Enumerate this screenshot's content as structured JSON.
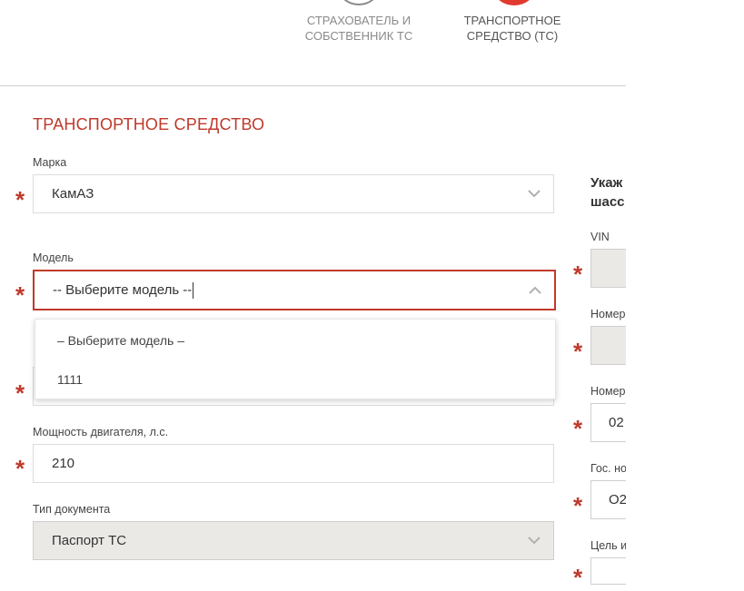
{
  "stepper": {
    "step1_label": "СТРАХОВАТЕЛЬ И\nСОБСТВЕННИК ТС",
    "step2_label": "ТРАНСПОРТНОЕ\nСРЕДСТВО (ТС)",
    "active_color": "#e03a2f"
  },
  "section": {
    "title": "ТРАНСПОРТНОЕ СРЕДСТВО"
  },
  "form": {
    "brand": {
      "label": "Марка",
      "value": "КамАЗ"
    },
    "model": {
      "label": "Модель",
      "value": "-- Выберите модель --"
    },
    "power": {
      "label": "Мощность двигателя, л.с.",
      "value": "210"
    },
    "doc_type": {
      "label": "Тип документа",
      "value": "Паспорт ТС"
    }
  },
  "model_dropdown": {
    "options": [
      "– Выберите модель –",
      "1111"
    ]
  },
  "right_panel": {
    "heading_line1": "Укаж",
    "heading_line2": "шасс",
    "vin_label": "VIN",
    "number1_label": "Номер",
    "number2_label": "Номер",
    "number2_value": "02",
    "gos_label": "Гос. но",
    "gos_value": "O2",
    "purpose_label": "Цель и"
  },
  "colors": {
    "accent": "#c0392b",
    "grey_field": "#ebe9e6"
  }
}
